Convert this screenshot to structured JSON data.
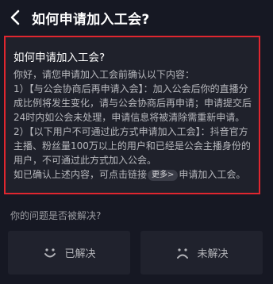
{
  "header": {
    "back_icon": "chevron-left-icon",
    "title": "如何申请加入工会?"
  },
  "card": {
    "question": "如何申请加入工会?",
    "answer_lines": [
      "你好，请您申请加入工会前确认以下内容：",
      "1）【与公会协商后再申请入会】：加入公会后你的直播分成比例将发生变化，请与公会协商后再申请；申请提交后24时内如公会未处理，申请信息将被清除需重新申请。",
      "2）【以下用户不可通过此方式申请加入工会】：抖音官方主播、粉丝量100万以上的用户和已经是公会主播身份的用户，不可通过此方式加入公会。"
    ],
    "last_line_prefix": "如已确认上述内容，可点击链接",
    "more_chip": "更多>",
    "last_line_suffix": "申请加入工会。"
  },
  "feedback": {
    "question": "你的问题是否被解决?",
    "solved_label": "已解决",
    "solved_icon": "smile-face-icon",
    "unsolved_label": "未解决",
    "unsolved_icon": "sad-face-icon"
  },
  "colors": {
    "background": "#161823",
    "highlight_border": "#e0262f"
  }
}
